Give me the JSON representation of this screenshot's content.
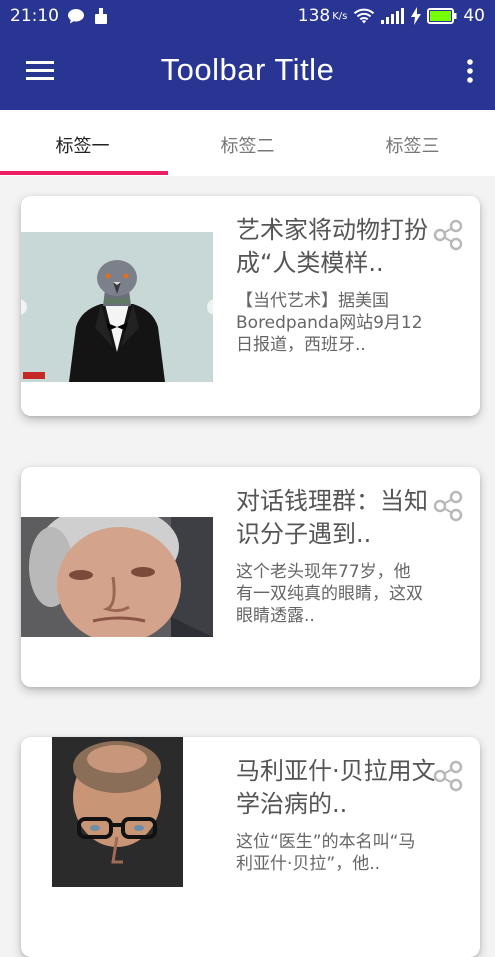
{
  "status_bar": {
    "time": "21:10",
    "speed": "138",
    "speed_unit": "K/s",
    "battery": "40"
  },
  "toolbar": {
    "title": "Toolbar Title"
  },
  "tabs": [
    {
      "label": "标签一",
      "active": true
    },
    {
      "label": "标签二",
      "active": false
    },
    {
      "label": "标签三",
      "active": false
    }
  ],
  "cards": [
    {
      "title": "艺术家将动物打扮成“人类模样..",
      "description": "【当代艺术】据美国Boredpanda网站9月12日报道，西班牙..",
      "image": "pigeon-in-suit"
    },
    {
      "title": "对话钱理群：当知识分子遇到..",
      "description": "这个老头现年77岁，他有一双纯真的眼睛，这双眼睛透露..",
      "image": "elderly-man-portrait"
    },
    {
      "title": "马利亚什·贝拉用文学治病的..",
      "description": "这位“医生”的本名叫“马利亚什·贝拉”，他..",
      "image": "man-with-glasses-portrait"
    }
  ],
  "colors": {
    "primary": "#283593",
    "accent": "#e91e63",
    "battery": "#76ff03"
  }
}
